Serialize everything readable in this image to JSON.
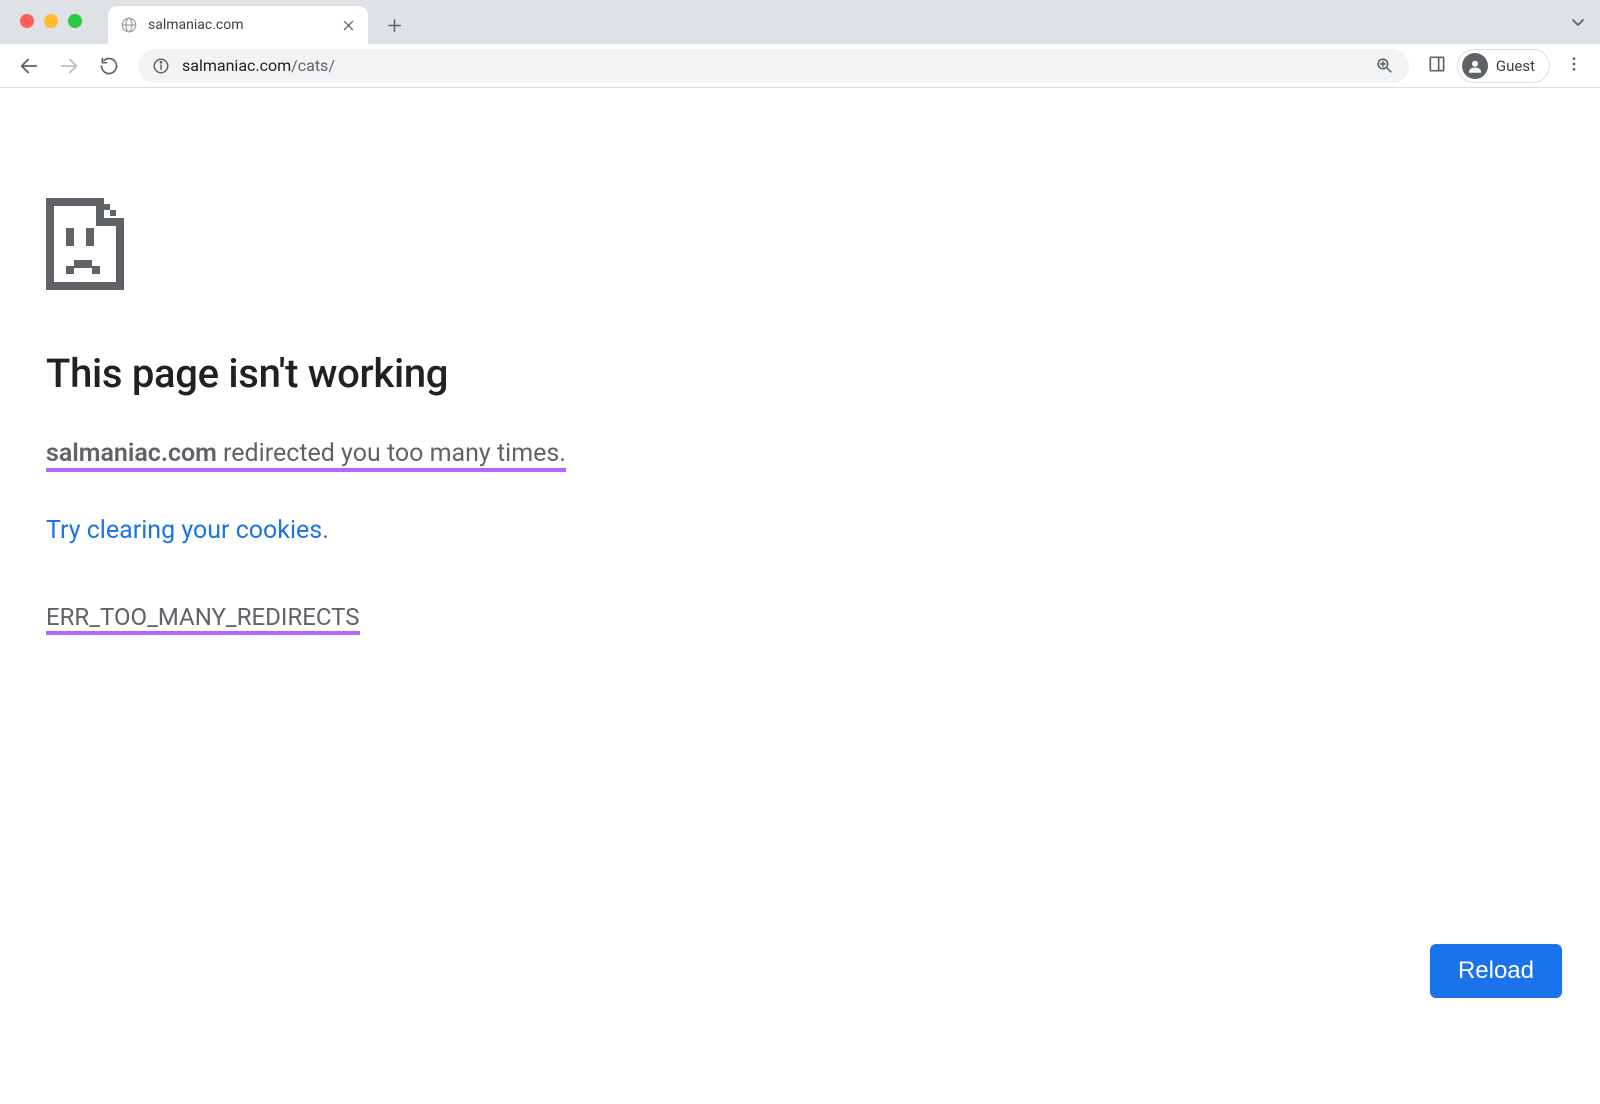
{
  "tabs": {
    "active": {
      "title": "salmaniac.com"
    }
  },
  "omnibox": {
    "host": "salmaniac.com",
    "path": "/cats/"
  },
  "profile": {
    "label": "Guest"
  },
  "error": {
    "title": "This page isn't working",
    "domain": "salmaniac.com",
    "redirect_msg": " redirected you too many times. ",
    "cookies_link": "Try clearing your cookies",
    "period": ".",
    "code": "ERR_TOO_MANY_REDIRECTS",
    "reload_label": "Reload"
  }
}
